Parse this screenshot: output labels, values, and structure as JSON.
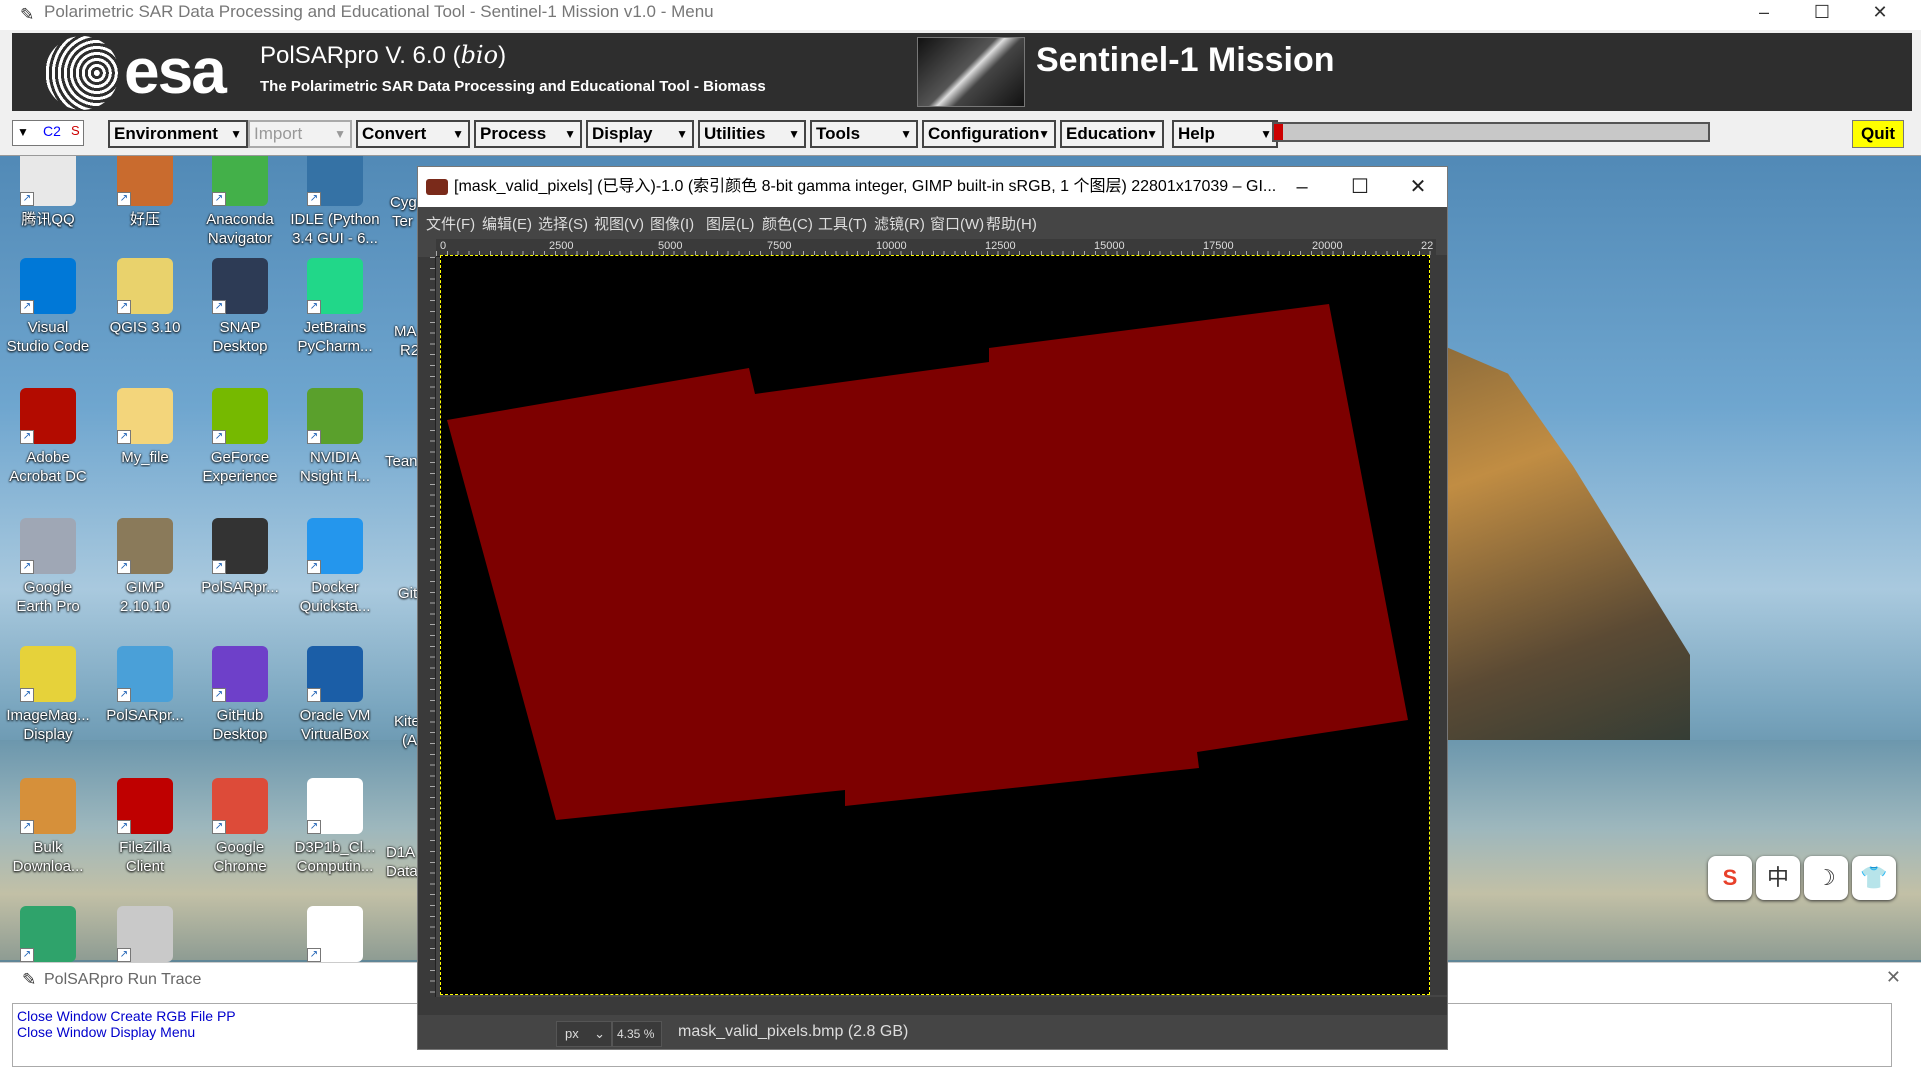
{
  "desktop": {
    "icons": [
      {
        "label1": "腾讯QQ",
        "label2": "",
        "icon": "qq-icon",
        "color": "#e8e8e8",
        "col": 0,
        "row": 0
      },
      {
        "label1": "好压",
        "label2": "",
        "icon": "haozip-icon",
        "color": "#c96b2e",
        "col": 1,
        "row": 0
      },
      {
        "label1": "Anaconda",
        "label2": "Navigator",
        "icon": "anaconda-icon",
        "color": "#43b049",
        "col": 2,
        "row": 0
      },
      {
        "label1": "IDLE (Python",
        "label2": "3.4 GUI - 6...",
        "icon": "python-idle-icon",
        "color": "#3572a5",
        "col": 3,
        "row": 0
      },
      {
        "label1": "Visual",
        "label2": "Studio Code",
        "icon": "vscode-icon",
        "color": "#0078d7",
        "col": 0,
        "row": 1
      },
      {
        "label1": "QGIS 3.10",
        "label2": "",
        "icon": "qgis-icon",
        "color": "#e9d26c",
        "col": 1,
        "row": 1
      },
      {
        "label1": "SNAP",
        "label2": "Desktop",
        "icon": "snap-icon",
        "color": "#2d3b55",
        "col": 2,
        "row": 1
      },
      {
        "label1": "JetBrains",
        "label2": "PyCharm...",
        "icon": "pycharm-icon",
        "color": "#21d789",
        "col": 3,
        "row": 1
      },
      {
        "label1": "Adobe",
        "label2": "Acrobat DC",
        "icon": "acrobat-icon",
        "color": "#b30b00",
        "col": 0,
        "row": 2
      },
      {
        "label1": "My_file",
        "label2": "",
        "icon": "folder-icon",
        "color": "#f3d57b",
        "col": 1,
        "row": 2
      },
      {
        "label1": "GeForce",
        "label2": "Experience",
        "icon": "geforce-icon",
        "color": "#76b900",
        "col": 2,
        "row": 2
      },
      {
        "label1": "NVIDIA",
        "label2": "Nsight H...",
        "icon": "nvidia-nsight-icon",
        "color": "#5aa02c",
        "col": 3,
        "row": 2
      },
      {
        "label1": "Google",
        "label2": "Earth Pro",
        "icon": "google-earth-icon",
        "color": "#9fa7b5",
        "col": 0,
        "row": 3
      },
      {
        "label1": "GIMP",
        "label2": "2.10.10",
        "icon": "gimp-icon",
        "color": "#8a7a5a",
        "col": 1,
        "row": 3
      },
      {
        "label1": "PolSARpr...",
        "label2": "",
        "icon": "polsarpro-icon",
        "color": "#333333",
        "col": 2,
        "row": 3
      },
      {
        "label1": "Docker",
        "label2": "Quicksta...",
        "icon": "docker-icon",
        "color": "#2496ed",
        "col": 3,
        "row": 3
      },
      {
        "label1": "ImageMag...",
        "label2": "Display",
        "icon": "imagemagick-icon",
        "color": "#e6d23a",
        "col": 0,
        "row": 4
      },
      {
        "label1": "PolSARpr...",
        "label2": "",
        "icon": "polsarpro-bio-icon",
        "color": "#4aa0d8",
        "col": 1,
        "row": 4
      },
      {
        "label1": "GitHub",
        "label2": "Desktop",
        "icon": "github-icon",
        "color": "#6e40c9",
        "col": 2,
        "row": 4
      },
      {
        "label1": "Oracle VM",
        "label2": "VirtualBox",
        "icon": "virtualbox-icon",
        "color": "#1b5ea7",
        "col": 3,
        "row": 4
      },
      {
        "label1": "Bulk",
        "label2": "Downloa...",
        "icon": "bulk-download-icon",
        "color": "#d6903a",
        "col": 0,
        "row": 5
      },
      {
        "label1": "FileZilla",
        "label2": "Client",
        "icon": "filezilla-icon",
        "color": "#bf0000",
        "col": 1,
        "row": 5
      },
      {
        "label1": "Google",
        "label2": "Chrome",
        "icon": "chrome-icon",
        "color": "#dd4b39",
        "col": 2,
        "row": 5
      },
      {
        "label1": "D3P1b_Cl...",
        "label2": "Computin...",
        "icon": "pdf-file-icon",
        "color": "#ffffff",
        "col": 3,
        "row": 5
      },
      {
        "label1": "",
        "label2": "",
        "icon": "app-icon-green",
        "color": "#2fa36b",
        "col": 0,
        "row": 6
      },
      {
        "label1": "",
        "label2": "",
        "icon": "image-file-icon",
        "color": "#c9c9c9",
        "col": 1,
        "row": 6
      },
      {
        "label1": "",
        "label2": "",
        "icon": "pdf-file-icon",
        "color": "#ffffff",
        "col": 3,
        "row": 6
      }
    ],
    "partial_labels": [
      "Cyg",
      "Ter",
      "MA",
      "R2",
      "Tean",
      "Git",
      "Kite",
      "(A",
      "D1A",
      "Data"
    ]
  },
  "polsarpro": {
    "window_title": "Polarimetric SAR Data Processing and Educational Tool - Sentinel-1 Mission v1.0 - Menu",
    "logo_text": "esa",
    "app_title": "PolSARpro V. 6.0 (",
    "bio_text": "bio",
    "app_title_end": ")",
    "subtitle": "The Polarimetric SAR Data Processing and Educational Tool - Biomass",
    "mission": "Sentinel-1 Mission",
    "mode_c": "C2",
    "mode_s": "S",
    "menus": [
      "Environment",
      "Import",
      "Convert",
      "Process",
      "Display",
      "Utilities",
      "Tools",
      "Configuration",
      "Education",
      "Help"
    ],
    "disabled_menu": "Import",
    "progress_fraction": 0.02,
    "quit_label": "Quit"
  },
  "trace": {
    "title": "PolSARpro Run Trace",
    "lines": [
      "Close Window Create RGB File PP",
      "Close Window Display Menu"
    ]
  },
  "gimp": {
    "title": "[mask_valid_pixels] (已导入)-1.0 (索引颜色 8-bit gamma integer, GIMP built-in sRGB, 1 个图层) 22801x17039 – GI...",
    "menus": [
      "文件(F)",
      "编辑(E)",
      "选择(S)",
      "视图(V)",
      "图像(I)",
      "图层(L)",
      "颜色(C)",
      "工具(T)",
      "滤镜(R)",
      "窗口(W)",
      "帮助(H)"
    ],
    "ruler_labels": [
      "0",
      "2500",
      "5000",
      "7500",
      "10000",
      "12500",
      "15000",
      "17500",
      "20000",
      "22"
    ],
    "unit": "px",
    "zoom": "4.35 %",
    "file_info": "mask_valid_pixels.bmp (2.8 GB)",
    "mask_color": "#7d0000"
  },
  "ime": {
    "buttons": [
      "S",
      "中",
      "☽",
      "👕"
    ]
  }
}
